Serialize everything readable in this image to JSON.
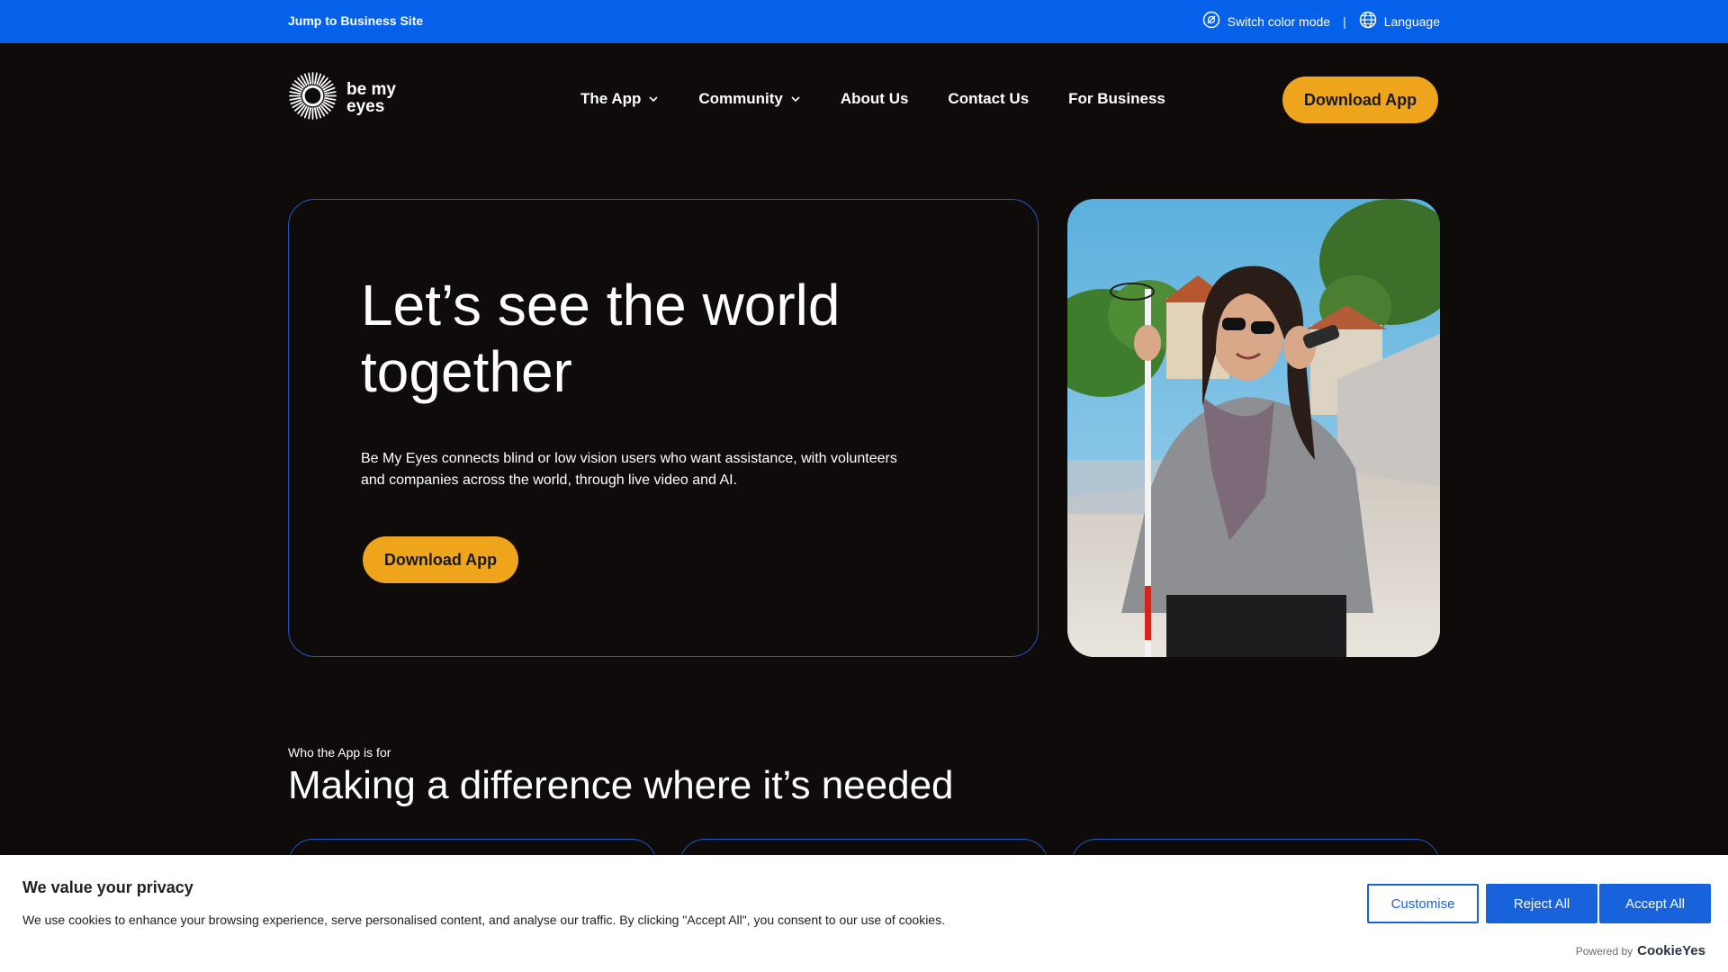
{
  "topbar": {
    "jump_link": "Jump to Business Site",
    "color_mode": "Switch color mode",
    "separator": "|",
    "language": "Language"
  },
  "header": {
    "logo_text_line1": "be my",
    "logo_text_line2": "eyes",
    "nav": [
      {
        "label": "The App",
        "has_dropdown": true
      },
      {
        "label": "Community",
        "has_dropdown": true
      },
      {
        "label": "About Us",
        "has_dropdown": false
      },
      {
        "label": "Contact Us",
        "has_dropdown": false
      },
      {
        "label": "For Business",
        "has_dropdown": false
      }
    ],
    "download_label": "Download App"
  },
  "hero": {
    "title": "Let’s see the world together",
    "description": "Be My Eyes connects blind or low vision users who want assistance, with volunteers and companies across the world, through live video and AI.",
    "download_label": "Download App"
  },
  "section": {
    "eyebrow": "Who the App is for",
    "title": "Making a difference where it’s needed"
  },
  "cookie": {
    "title": "We value your privacy",
    "text": "We use cookies to enhance your browsing experience, serve personalised content, and analyse our traffic. By clicking \"Accept All\", you consent to our use of cookies.",
    "customise": "Customise",
    "reject": "Reject All",
    "accept": "Accept All",
    "powered_by": "Powered by",
    "brand": "CookieYes"
  },
  "colors": {
    "topbar": "#0560ea",
    "background": "#0f0b0a",
    "accent_yellow": "#eea51b",
    "card_border": "#2357c7",
    "cookie_blue": "#1863dc"
  },
  "icons": {
    "color_mode": "color-mode-icon",
    "language": "globe-icon",
    "dropdown": "chevron-down-icon",
    "logo": "sunburst-eye-logo"
  }
}
